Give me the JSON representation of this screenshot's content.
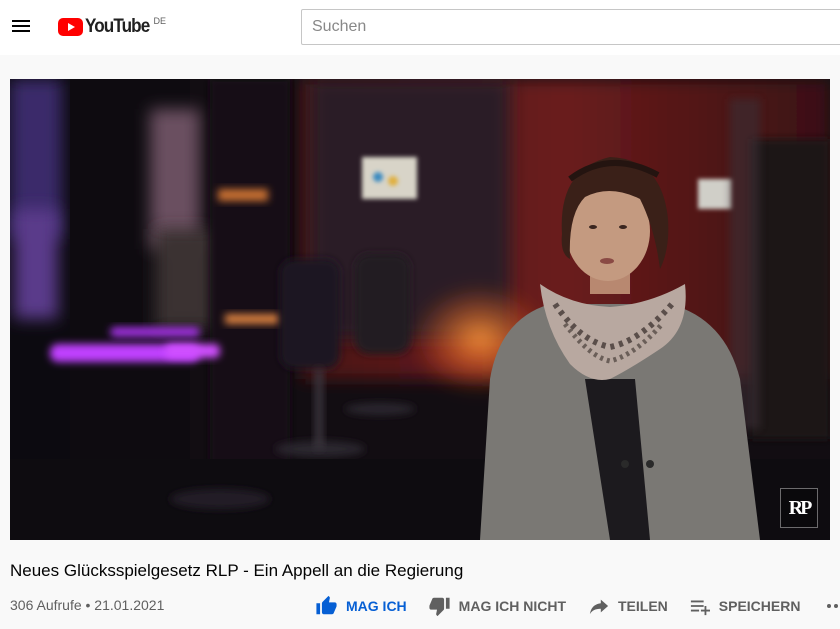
{
  "header": {
    "logo_text": "YouTube",
    "region": "DE",
    "search_placeholder": "Suchen"
  },
  "player": {
    "watermark": "RP"
  },
  "video": {
    "title": "Neues Glücksspielgesetz RLP - Ein Appell an die Regierung",
    "meta": "306 Aufrufe • 21.01.2021"
  },
  "actions": {
    "like": "MAG ICH",
    "dislike": "MAG ICH NICHT",
    "share": "TEILEN",
    "save": "SPEICHERN"
  },
  "colors": {
    "brand_red": "#ff0000",
    "like_blue": "#065fd4"
  },
  "icons": {
    "menu": "menu-icon",
    "like": "thumbs-up-icon",
    "dislike": "thumbs-down-icon",
    "share": "share-arrow-icon",
    "save": "playlist-add-icon",
    "more": "more-horizontal-icon"
  }
}
